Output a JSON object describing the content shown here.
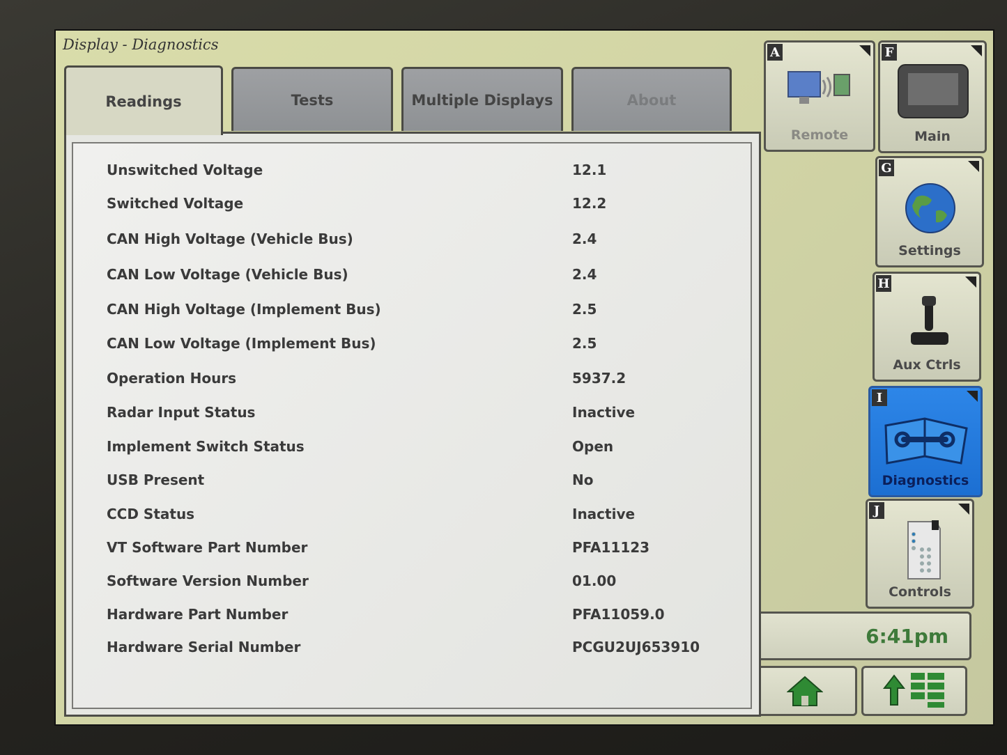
{
  "window": {
    "title": "Display - Diagnostics"
  },
  "tabs": [
    {
      "label": "Readings",
      "state": "active"
    },
    {
      "label": "Tests",
      "state": "inactive"
    },
    {
      "label": "Multiple Displays",
      "state": "inactive"
    },
    {
      "label": "About",
      "state": "disabled"
    }
  ],
  "readings": [
    {
      "label": "Unswitched Voltage",
      "value": "12.1"
    },
    {
      "label": "Switched Voltage",
      "value": "12.2"
    },
    {
      "label": "CAN High Voltage (Vehicle Bus)",
      "value": "2.4"
    },
    {
      "label": "CAN Low Voltage (Vehicle Bus)",
      "value": "2.4"
    },
    {
      "label": "CAN High Voltage (Implement Bus)",
      "value": "2.5"
    },
    {
      "label": "CAN Low Voltage (Implement Bus)",
      "value": "2.5"
    },
    {
      "label": "Operation Hours",
      "value": "5937.2"
    },
    {
      "label": "Radar Input Status",
      "value": "Inactive"
    },
    {
      "label": "Implement Switch Status",
      "value": "Open"
    },
    {
      "label": "USB Present",
      "value": "No"
    },
    {
      "label": "CCD Status",
      "value": "Inactive"
    },
    {
      "label": "VT Software Part Number",
      "value": "PFA11123"
    },
    {
      "label": "Software Version Number",
      "value": "01.00"
    },
    {
      "label": "Hardware Part Number",
      "value": "PFA11059.0"
    },
    {
      "label": "Hardware Serial Number",
      "value": "PCGU2UJ653910"
    }
  ],
  "sidebar": {
    "buttons": [
      {
        "key": "A",
        "label": "Remote",
        "icon": "remote-icon",
        "state": "disabled"
      },
      {
        "key": "F",
        "label": "Main",
        "icon": "display-icon",
        "state": "normal"
      },
      {
        "key": "G",
        "label": "Settings",
        "icon": "globe-icon",
        "state": "normal"
      },
      {
        "key": "H",
        "label": "Aux Ctrls",
        "icon": "joystick-icon",
        "state": "normal"
      },
      {
        "key": "I",
        "label": "Diagnostics",
        "icon": "wrench-book-icon",
        "state": "selected"
      },
      {
        "key": "J",
        "label": "Controls",
        "icon": "keypad-icon",
        "state": "normal"
      }
    ]
  },
  "clock": {
    "time": "6:41pm"
  },
  "bottom": {
    "home_icon": "home-icon",
    "layout_icon": "up-arrow-layout-icon"
  },
  "colors": {
    "selected": "#1c6fd2",
    "clock_text": "#3e7a3a",
    "screen_bg": "#d3d6a6"
  }
}
